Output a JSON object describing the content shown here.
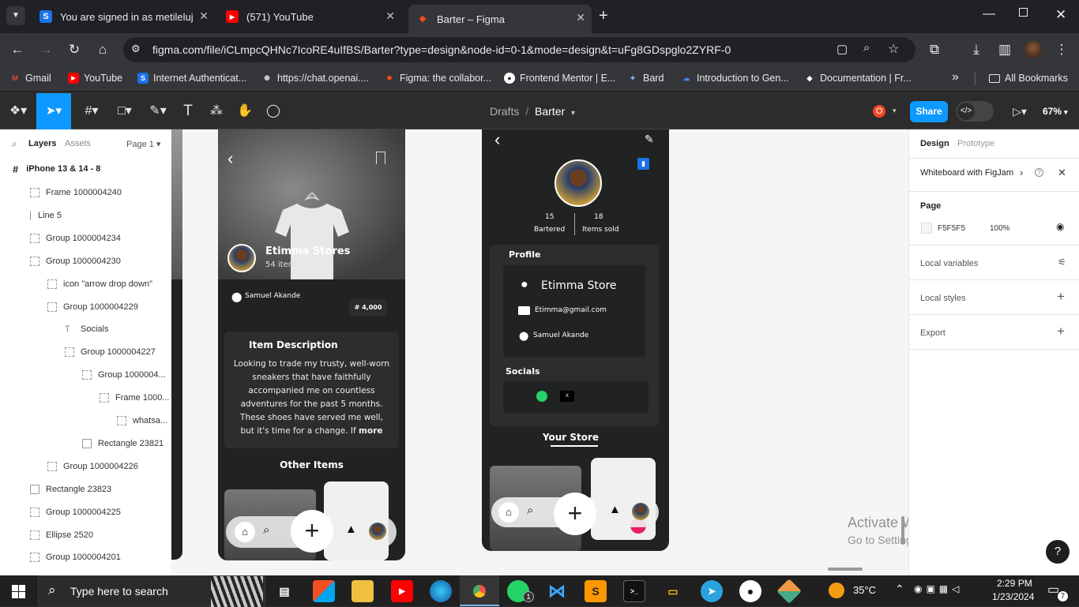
{
  "tabs": [
    {
      "title": "You are signed in as metileluj",
      "icon": "signed-in-s-icon"
    },
    {
      "title": "(571) YouTube",
      "icon": "youtube-icon"
    },
    {
      "title": "Barter – Figma",
      "icon": "figma-icon"
    }
  ],
  "address": {
    "url": "figma.com/file/iCLmpcQHNc7IcoRE4uIfBS/Barter?type=design&node-id=0-1&mode=design&t=uFg8GDspglo2ZYRF-0"
  },
  "bookmarks": [
    "Gmail",
    "YouTube",
    "Internet Authenticat...",
    "https://chat.openai....",
    "Figma: the collabor...",
    "Frontend Mentor | E...",
    "Bard",
    "Introduction to Gen...",
    "Documentation | Fr..."
  ],
  "bookmarks_more": "»",
  "all_bookmarks": "All Bookmarks",
  "figma": {
    "breadcrumb_drafts": "Drafts",
    "breadcrumb_sep": "/",
    "file_name": "Barter",
    "avatar_letter": "O",
    "share": "Share",
    "zoom": "67%"
  },
  "left_panel": {
    "tabs": [
      "Layers",
      "Assets"
    ],
    "page_selector": "Page 1",
    "frame_title": "iPhone 13 & 14 - 8",
    "layers": [
      "Frame 1000004240",
      "Line 5",
      "Group 1000004234",
      "Group 1000004230",
      "icon \"arrow drop down\"",
      "Group 1000004229",
      "Socials",
      "Group 1000004227",
      "Group 1000004...",
      "Frame 1000...",
      "whatsa...",
      "Rectangle 23821",
      "Group 1000004226",
      "Rectangle 23823",
      "Group 1000004225",
      "Ellipse 2520",
      "Group 1000004201"
    ]
  },
  "right_panel": {
    "tabs": [
      "Design",
      "Prototype"
    ],
    "whiteboard": "Whiteboard with FigJam",
    "page_label": "Page",
    "page_color": "F5F5F5",
    "page_opacity": "100%",
    "local_variables": "Local variables",
    "local_styles": "Local styles",
    "export": "Export"
  },
  "phone1": {
    "store_name": "Etimma Stores",
    "items_count": "54 items",
    "location": "Samuel Akande",
    "price": "# 4,000",
    "desc_title": "Item Description",
    "desc_text": "Looking to trade my trusty, well-worn sneakers that have faithfully accompanied me on countless adventures for the past 5 months. These shoes have served me well, but it's time for a change. If",
    "desc_more": "more",
    "other_items": "Other Items"
  },
  "phone2": {
    "bartered_count": "15",
    "bartered_label": "Bartered",
    "sold_count": "18",
    "sold_label": "Items sold",
    "profile_title": "Profile",
    "store_name": "Etimma Store",
    "email": "Etimma@gmail.com",
    "location": "Samuel Akande",
    "socials_title": "Socials",
    "your_store": "Your Store"
  },
  "watermark": {
    "line1": "Activate Windows",
    "line2": "Go to Settings to activate Windows."
  },
  "help": "?",
  "taskbar": {
    "search_placeholder": "Type here to search",
    "weather": "35°C",
    "time": "2:29 PM",
    "date": "1/23/2024",
    "notifications": "7",
    "whatsapp_badge": "1"
  }
}
